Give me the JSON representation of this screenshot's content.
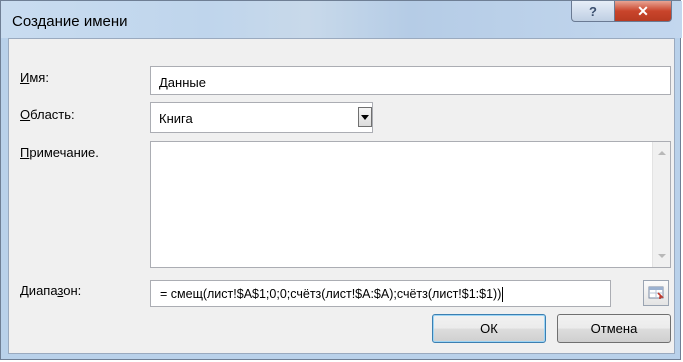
{
  "window": {
    "title": "Создание имени",
    "help_glyph": "?",
    "close_glyph": "✕"
  },
  "form": {
    "name": {
      "label_u": "И",
      "label_rest": "мя:",
      "value": "Данные"
    },
    "scope": {
      "label_u": "О",
      "label_rest": "бласть:",
      "value": "Книга"
    },
    "comment": {
      "label_u": "П",
      "label_rest": "римечание.",
      "value": ""
    },
    "range": {
      "label_pre": "Диапа",
      "label_u": "з",
      "label_post": "он:",
      "value": "= смещ(лист!$A$1;0;0;счётз(лист!$A:$A);счётз(лист!$1:$1))"
    }
  },
  "buttons": {
    "ok": "ОК",
    "cancel": "Отмена"
  },
  "colors": {
    "accent": "#3c7fb1",
    "close": "#c9452c",
    "frame": "#b9d1ea"
  }
}
